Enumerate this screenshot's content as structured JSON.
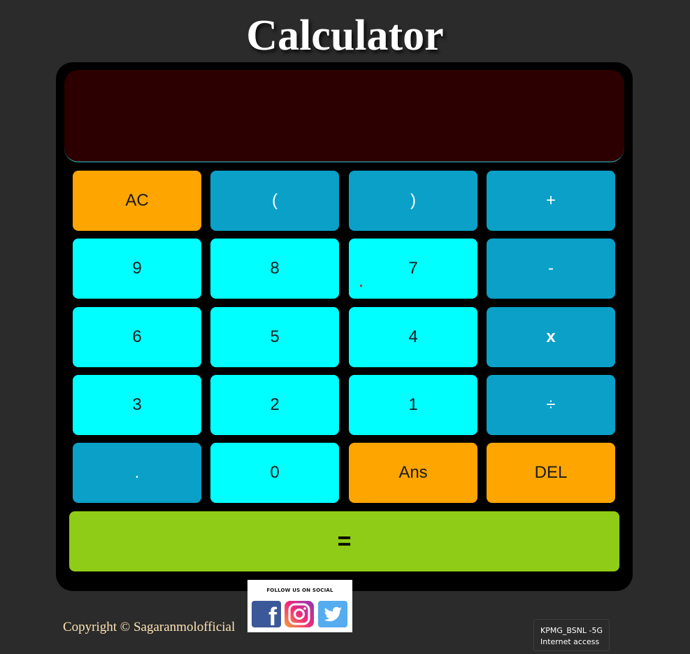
{
  "title": "Calculator",
  "display": {
    "value": ""
  },
  "keys": [
    {
      "label": "AC",
      "name": "ac-button",
      "style": "orange"
    },
    {
      "label": "(",
      "name": "open-paren-button",
      "style": "blue"
    },
    {
      "label": ")",
      "name": "close-paren-button",
      "style": "blue"
    },
    {
      "label": "+",
      "name": "add-button",
      "style": "blue"
    },
    {
      "label": "9",
      "name": "digit-9-button",
      "style": "cyan"
    },
    {
      "label": "8",
      "name": "digit-8-button",
      "style": "cyan"
    },
    {
      "label": "7",
      "name": "digit-7-button",
      "style": "cyan"
    },
    {
      "label": "-",
      "name": "subtract-button",
      "style": "blue"
    },
    {
      "label": "6",
      "name": "digit-6-button",
      "style": "cyan"
    },
    {
      "label": "5",
      "name": "digit-5-button",
      "style": "cyan"
    },
    {
      "label": "4",
      "name": "digit-4-button",
      "style": "cyan"
    },
    {
      "label": "x",
      "name": "multiply-button",
      "style": "blue bold"
    },
    {
      "label": "3",
      "name": "digit-3-button",
      "style": "cyan"
    },
    {
      "label": "2",
      "name": "digit-2-button",
      "style": "cyan"
    },
    {
      "label": "1",
      "name": "digit-1-button",
      "style": "cyan"
    },
    {
      "label": "÷",
      "name": "divide-button",
      "style": "blue"
    },
    {
      "label": ".",
      "name": "decimal-button",
      "style": "blue"
    },
    {
      "label": "0",
      "name": "digit-0-button",
      "style": "cyan"
    },
    {
      "label": "Ans",
      "name": "ans-button",
      "style": "orange"
    },
    {
      "label": "DEL",
      "name": "delete-button",
      "style": "orange"
    }
  ],
  "equals_label": "=",
  "footer": {
    "copyright": "Copyright © Sagaranmolofficial",
    "social_caption": "FOLLOW US ON SOCIAL",
    "social_icons": [
      "facebook-icon",
      "instagram-icon",
      "twitter-icon"
    ]
  },
  "network_tooltip": {
    "network_name": "KPMG_BSNL -5G",
    "status": "Internet access"
  },
  "colors": {
    "background": "#2b2b2b",
    "display": "#2c0000",
    "orange_key": "#ffa500",
    "blue_key": "#0aa0c8",
    "cyan_key": "#00ffff",
    "equals_key": "#8fcc17"
  }
}
